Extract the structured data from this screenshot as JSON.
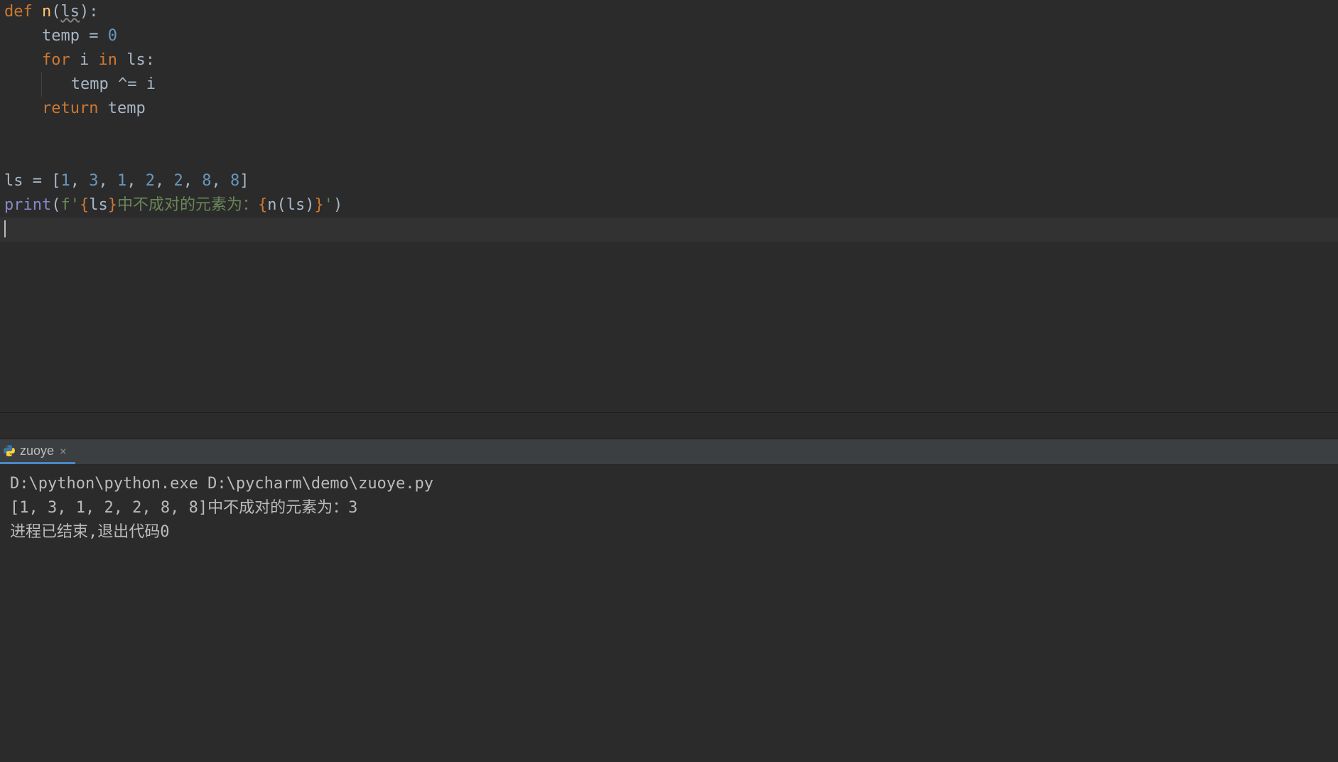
{
  "editor": {
    "tokens": {
      "t_def": "def",
      "t_fname": "n",
      "t_lparen": "(",
      "t_param_ls": "ls",
      "t_rparen": ")",
      "t_colon": ":",
      "t_temp": "temp ",
      "t_eq": "= ",
      "t_zero": "0",
      "t_for": "for ",
      "t_i": "i ",
      "t_in": "in ",
      "t_ls2": "ls",
      "t_colon2": ":",
      "t_temp2": "temp ",
      "t_xoreq": "^= ",
      "t_i2": "i",
      "t_return": "return ",
      "t_temp3": "temp",
      "t_ls_assign": "ls ",
      "t_eq2": "= ",
      "t_lbracket": "[",
      "t_n1": "1",
      "t_n3": "3",
      "t_n1b": "1",
      "t_n2": "2",
      "t_n2b": "2",
      "t_n8": "8",
      "t_n8b": "8",
      "t_rbracket": "]",
      "t_comma": ", ",
      "t_print": "print",
      "t_fprefix": "f'",
      "t_lbrace": "{",
      "t_ls3": "ls",
      "t_rbrace": "}",
      "t_cn_text": "中不成对的元素为：",
      "t_lbrace2": "{",
      "t_ncall": "n",
      "t_lparen2": "(",
      "t_ls4": "ls",
      "t_rparen2": ")",
      "t_rbrace2": "}",
      "t_endquote": "'",
      "t_rparen3": ")"
    }
  },
  "run_tab": {
    "label": "zuoye"
  },
  "console": {
    "line1": "D:\\python\\python.exe D:\\pycharm\\demo\\zuoye.py",
    "line2": "[1, 3, 1, 2, 2, 8, 8]中不成对的元素为：3",
    "line3": "",
    "line4": "进程已结束,退出代码0"
  }
}
